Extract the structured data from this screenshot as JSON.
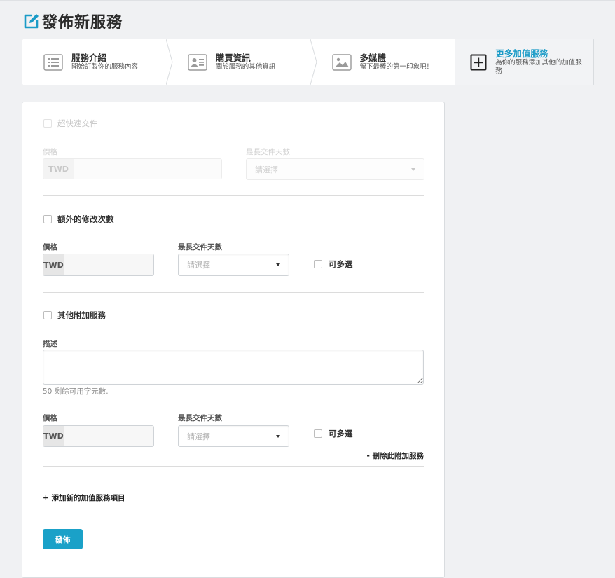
{
  "page": {
    "title": "發佈新服務"
  },
  "steps": [
    {
      "title": "服務介紹",
      "subtitle": "開始訂製你的服務內容",
      "icon": "list-icon"
    },
    {
      "title": "購買資訊",
      "subtitle": "關於服務的其他資訊",
      "icon": "contact-card-icon"
    },
    {
      "title": "多媒體",
      "subtitle": "留下最棒的第一印象吧！",
      "icon": "image-icon"
    },
    {
      "title": "更多加值服務",
      "subtitle": "為你的服務添加其他的加值服務",
      "icon": "plus-square-icon"
    }
  ],
  "form": {
    "express": {
      "checkbox_label": "超快速交件",
      "price_label": "價格",
      "currency": "TWD",
      "price_value": "",
      "days_label": "最長交件天數",
      "days_placeholder": "請選擇"
    },
    "revisions": {
      "checkbox_label": "額外的修改次數",
      "price_label": "價格",
      "currency": "TWD",
      "price_value": "",
      "days_label": "最長交件天數",
      "days_placeholder": "請選擇",
      "multi_label": "可多選"
    },
    "other": {
      "checkbox_label": "其他附加服務",
      "desc_label": "描述",
      "desc_value": "",
      "chars_hint": "50 剩餘可用字元數.",
      "price_label": "價格",
      "currency": "TWD",
      "price_value": "",
      "days_label": "最長交件天數",
      "days_placeholder": "請選擇",
      "multi_label": "可多選",
      "remove_label": "- 刪除此附加服務"
    },
    "add_label": "+ 添加新的加值服務項目",
    "publish_label": "發佈"
  },
  "colors": {
    "accent": "#1aa1c8",
    "active_step_title": "#1a9bc7",
    "background": "#f0f1f3"
  }
}
